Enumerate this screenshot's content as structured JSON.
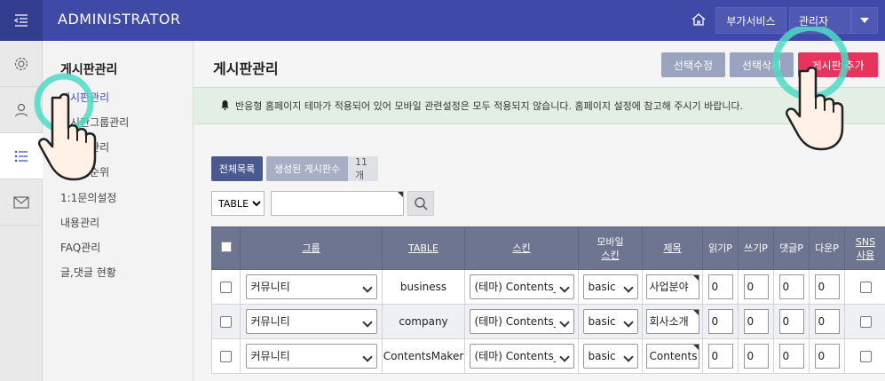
{
  "app": {
    "brand": "ADMINISTRATOR"
  },
  "topbar": {
    "addon_label": "부가서비스",
    "admin_label": "관리자"
  },
  "submenu": {
    "title": "게시판관리",
    "items": [
      "게시판관리",
      "게시판그룹관리",
      "게시판관리",
      "게시판순위",
      "1:1문의설정",
      "내용관리",
      "FAQ관리",
      "글,댓글 현황"
    ]
  },
  "main": {
    "title": "게시판관리",
    "buttons": {
      "select_edit": "선택수정",
      "select_delete": "선택삭제",
      "add_board": "게시판 추가"
    },
    "notice": "반응형 홈페이지 테마가 적용되어 있어 모바일 관련설정은 모두 적용되지 않습니다. 홈페이지 설정에 참고해 주시기 바랍니다.",
    "tabs": {
      "all": "전체목록",
      "created": "생성된 게시판수",
      "count": "11개"
    },
    "filter": {
      "field_value": "TABLE",
      "search_value": ""
    }
  },
  "table": {
    "headers": {
      "group": "그룹",
      "table": "TABLE",
      "skin": "스킨",
      "mobile_skin_1": "모바일",
      "mobile_skin_2": "스킨",
      "subject": "제목",
      "read": "읽기P",
      "write": "쓰기P",
      "comment": "댓글P",
      "download": "다운P",
      "sns_1": "SNS",
      "sns_2": "사용"
    },
    "rows": [
      {
        "group": "커뮤니티",
        "table": "business",
        "skin": "(테마) Contents_M",
        "mobile": "basic",
        "subject": "사업분야",
        "read": "0",
        "write": "0",
        "comment": "0",
        "download": "0"
      },
      {
        "group": "커뮤니티",
        "table": "company",
        "skin": "(테마) Contents_M",
        "mobile": "basic",
        "subject": "회사소개",
        "read": "0",
        "write": "0",
        "comment": "0",
        "download": "0"
      },
      {
        "group": "커뮤니티",
        "table": "ContentsMaker",
        "skin": "(테마) Contents_M",
        "mobile": "basic",
        "subject": "Contents M",
        "read": "0",
        "write": "0",
        "comment": "0",
        "download": "0"
      }
    ]
  },
  "colors": {
    "topbar": "#3f4aa8",
    "accent_add": "#e8335f",
    "highlight_ring": "#4fd9c4",
    "table_header": "#6e7590"
  }
}
